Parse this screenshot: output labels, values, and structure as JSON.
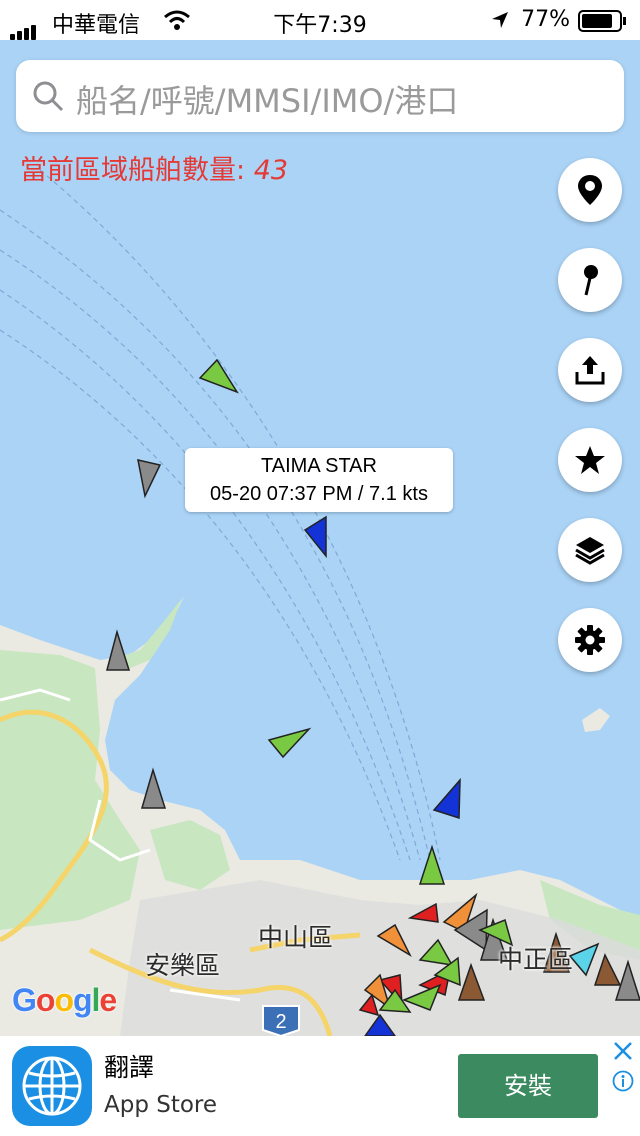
{
  "status_bar": {
    "carrier": "中華電信",
    "time": "下午7:39",
    "battery": "77%"
  },
  "search": {
    "placeholder": "船名/呼號/MMSI/IMO/港口"
  },
  "vessel_count": {
    "label": "當前區域船舶數量: ",
    "value": "43"
  },
  "map_buttons": [
    {
      "name": "my-location-icon"
    },
    {
      "name": "drop-pin-icon"
    },
    {
      "name": "share-icon"
    },
    {
      "name": "favorites-star-icon"
    },
    {
      "name": "layers-icon"
    },
    {
      "name": "settings-gear-icon"
    }
  ],
  "tooltip": {
    "ship_name": "TAIMA STAR",
    "info": "05-20 07:37 PM / 7.1 kts"
  },
  "places": {
    "zhongshan": "中山區",
    "anle": "安樂區",
    "zhongzheng": "中正區",
    "road_shield": "2"
  },
  "map_attribution": "Google",
  "ad": {
    "title": "翻譯",
    "subtitle": "App Store",
    "cta": "安裝"
  },
  "colors": {
    "sea": "#aad3f6",
    "land": "#eaeae3",
    "green_area": "#c8e6c0",
    "accent_red": "#e53935",
    "ad_button": "#3c8a5f"
  }
}
